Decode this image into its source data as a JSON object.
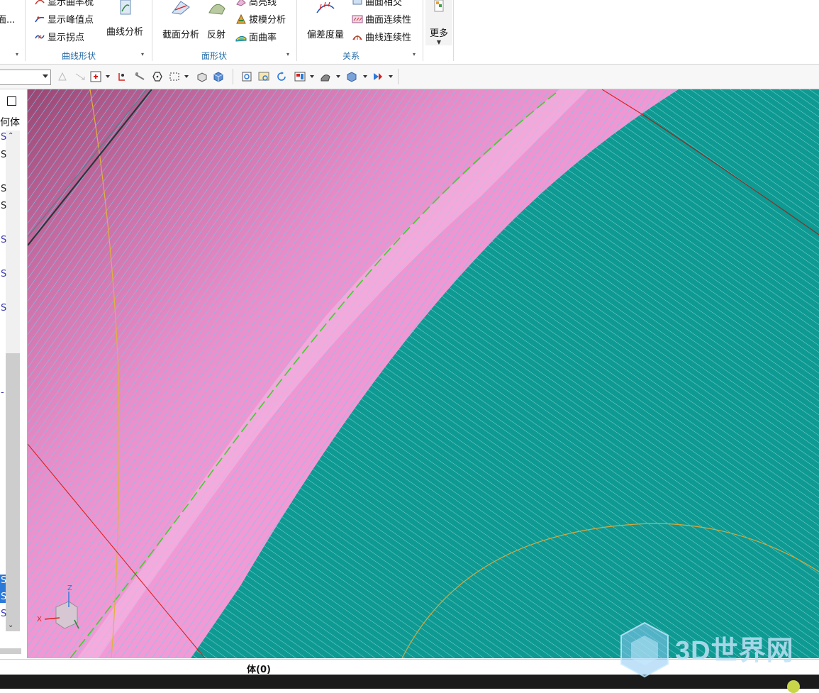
{
  "ribbon": {
    "curve_group": {
      "title": "曲线形状",
      "btn_curvature_comb": "显示曲率梳",
      "btn_peak": "显示峰值点",
      "btn_inflection": "显示拐点",
      "btn_curve_analysis": "曲线分析",
      "btn_cut_face": "面..."
    },
    "face_group": {
      "title": "面形状",
      "btn_section": "截面分析",
      "btn_reflection": "反射",
      "btn_highlight": "高亮线",
      "btn_draft": "拔模分析",
      "btn_face_curvature": "面曲率"
    },
    "relation_group": {
      "title": "关系",
      "btn_deviation": "偏差度量",
      "btn_face_intersect": "曲面相交",
      "btn_face_continuity": "曲面连续性",
      "btn_curve_continuity": "曲线连续性"
    },
    "more_group": {
      "btn_more": "更多"
    }
  },
  "left_panel": {
    "header": "何体",
    "row_letter": "S",
    "dash": "-"
  },
  "viewport": {
    "axis_z": "Z",
    "axis_x": "X"
  },
  "status_bar": {
    "text": "体(0)"
  },
  "watermark": {
    "text": "3D世界网"
  },
  "colors": {
    "pink_surface": "#f29ad6",
    "teal_surface": "#0e9a93",
    "hatch_line": "#74c7ee",
    "edge_red": "#d8201e",
    "edge_yellow": "#e0b23a",
    "accent_blue": "#2b79d9"
  }
}
